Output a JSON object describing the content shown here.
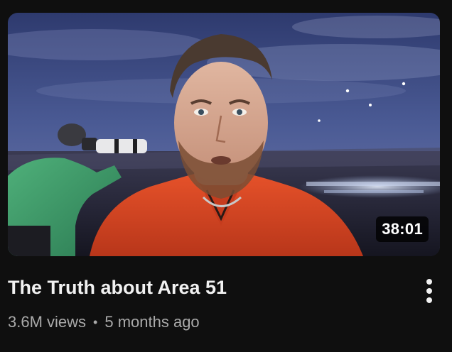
{
  "video": {
    "title": "The Truth about Area 51",
    "views": "3.6M views",
    "separator": "•",
    "age": "5 months ago",
    "duration": "38:01"
  },
  "icons": {
    "menu": "more-vertical-icon"
  },
  "colors": {
    "background": "#0f0f0f",
    "title": "#f1f1f1",
    "meta": "#aaaaaa",
    "jacket": "#e0461f"
  }
}
